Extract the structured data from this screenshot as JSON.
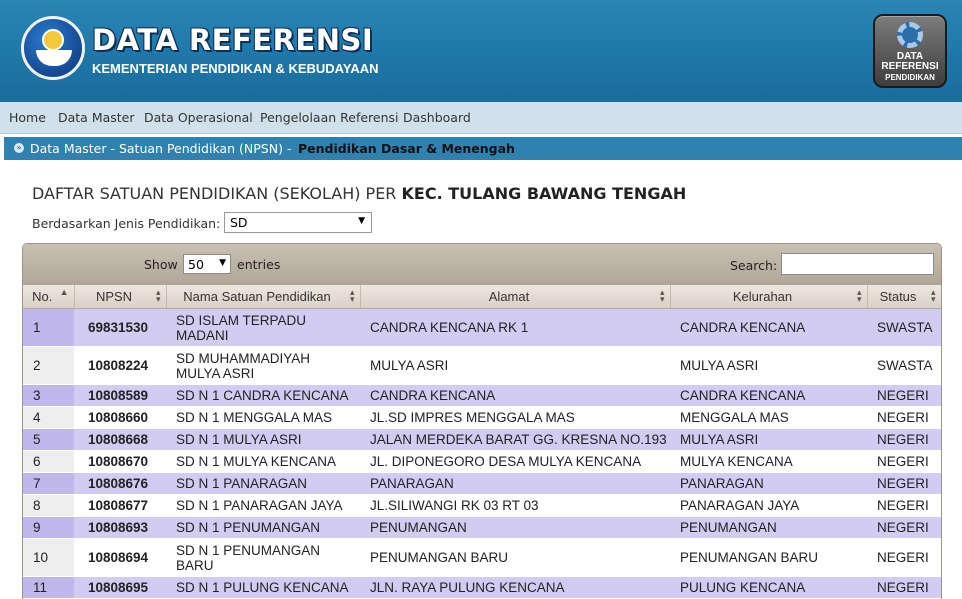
{
  "header": {
    "title": "DATA REFERENSI",
    "subtitle": "KEMENTERIAN PENDIDIKAN & KEBUDAYAAN",
    "app_icon_line1": "DATA",
    "app_icon_line2": "REFERENSI",
    "app_icon_line3": "PENDIDIKAN"
  },
  "nav": [
    {
      "label": "Home"
    },
    {
      "label": "Data Master"
    },
    {
      "label": "Data Operasional"
    },
    {
      "label": "Pengelolaan Referensi"
    },
    {
      "label": "Dashboard"
    }
  ],
  "breadcrumb": {
    "path": "Data Master - Satuan Pendidikan (NPSN) -",
    "current": "Pendidikan Dasar & Menengah"
  },
  "page": {
    "heading_prefix": "DAFTAR SATUAN PENDIDIKAN (SEKOLAH) PER",
    "heading_location": "KEC. TULANG BAWANG TENGAH",
    "filter_label": "Berdasarkan Jenis Pendidikan:",
    "filter_value": "SD"
  },
  "table_controls": {
    "show_label": "Show",
    "length_value": "50",
    "entries_label": "entries",
    "search_label": "Search:",
    "search_value": ""
  },
  "table": {
    "columns": [
      "No.",
      "NPSN",
      "Nama Satuan Pendidikan",
      "Alamat",
      "Kelurahan",
      "Status"
    ],
    "rows": [
      {
        "no": "1",
        "npsn": "69831530",
        "nama": "SD ISLAM TERPADU MADANI",
        "alamat": "CANDRA KENCANA RK 1",
        "kelurahan": "CANDRA KENCANA",
        "status": "SWASTA"
      },
      {
        "no": "2",
        "npsn": "10808224",
        "nama": "SD MUHAMMADIYAH MULYA ASRI",
        "alamat": "MULYA ASRI",
        "kelurahan": "MULYA ASRI",
        "status": "SWASTA"
      },
      {
        "no": "3",
        "npsn": "10808589",
        "nama": "SD N 1 CANDRA KENCANA",
        "alamat": "CANDRA KENCANA",
        "kelurahan": "CANDRA KENCANA",
        "status": "NEGERI"
      },
      {
        "no": "4",
        "npsn": "10808660",
        "nama": "SD N 1 MENGGALA MAS",
        "alamat": "JL.SD IMPRES MENGGALA MAS",
        "kelurahan": "MENGGALA MAS",
        "status": "NEGERI"
      },
      {
        "no": "5",
        "npsn": "10808668",
        "nama": "SD N 1 MULYA ASRI",
        "alamat": "JALAN MERDEKA BARAT GG. KRESNA NO.193",
        "kelurahan": "MULYA ASRI",
        "status": "NEGERI"
      },
      {
        "no": "6",
        "npsn": "10808670",
        "nama": "SD N 1 MULYA KENCANA",
        "alamat": "JL. DIPONEGORO DESA MULYA KENCANA",
        "kelurahan": "MULYA KENCANA",
        "status": "NEGERI"
      },
      {
        "no": "7",
        "npsn": "10808676",
        "nama": "SD N 1 PANARAGAN",
        "alamat": "PANARAGAN",
        "kelurahan": "PANARAGAN",
        "status": "NEGERI"
      },
      {
        "no": "8",
        "npsn": "10808677",
        "nama": "SD N 1 PANARAGAN JAYA",
        "alamat": "JL.SILIWANGI RK 03 RT 03",
        "kelurahan": "PANARAGAN JAYA",
        "status": "NEGERI"
      },
      {
        "no": "9",
        "npsn": "10808693",
        "nama": "SD N 1 PENUMANGAN",
        "alamat": "PENUMANGAN",
        "kelurahan": "PENUMANGAN",
        "status": "NEGERI"
      },
      {
        "no": "10",
        "npsn": "10808694",
        "nama": "SD N 1 PENUMANGAN BARU",
        "alamat": "PENUMANGAN BARU",
        "kelurahan": "PENUMANGAN BARU",
        "status": "NEGERI"
      },
      {
        "no": "11",
        "npsn": "10808695",
        "nama": "SD N 1 PULUNG KENCANA",
        "alamat": "JLN. RAYA PULUNG KENCANA",
        "kelurahan": "PULUNG KENCANA",
        "status": "NEGERI"
      }
    ]
  },
  "colors": {
    "header_blue": "#1e77a8",
    "nav_bg": "#d1e1ec",
    "breadcrumb_bg": "#2f81b0",
    "row_odd": "#d2ccf2",
    "row_even": "#ffffff"
  }
}
